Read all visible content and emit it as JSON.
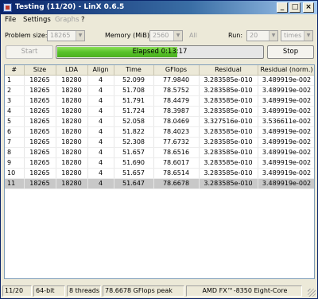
{
  "window": {
    "title": "Testing (11/20) - LinX 0.6.5"
  },
  "titlebar_buttons": {
    "minimize": "_",
    "maximize": "□",
    "close": "×"
  },
  "menu": {
    "file": "File",
    "settings": "Settings",
    "graphs": "Graphs",
    "help": "?"
  },
  "controls": {
    "problem_size_label": "Problem size:",
    "problem_size_value": "18265",
    "memory_label": "Memory (MiB):",
    "memory_value": "2560",
    "all_label": "All",
    "run_label": "Run:",
    "run_value": "20",
    "run_unit": "times"
  },
  "buttons": {
    "start": "Start",
    "stop": "Stop"
  },
  "progress": {
    "text": "Elapsed 0:13:17",
    "fraction": 0.58
  },
  "table": {
    "headers": [
      "#",
      "Size",
      "LDA",
      "Align",
      "Time",
      "GFlops",
      "Residual",
      "Residual (norm.)"
    ],
    "rows": [
      [
        "1",
        "18265",
        "18280",
        "4",
        "52.099",
        "77.9840",
        "3.283585e-010",
        "3.489919e-002"
      ],
      [
        "2",
        "18265",
        "18280",
        "4",
        "51.708",
        "78.5752",
        "3.283585e-010",
        "3.489919e-002"
      ],
      [
        "3",
        "18265",
        "18280",
        "4",
        "51.791",
        "78.4479",
        "3.283585e-010",
        "3.489919e-002"
      ],
      [
        "4",
        "18265",
        "18280",
        "4",
        "51.724",
        "78.3987",
        "3.283585e-010",
        "3.489919e-002"
      ],
      [
        "5",
        "18265",
        "18280",
        "4",
        "52.058",
        "78.0469",
        "3.327516e-010",
        "3.536611e-002"
      ],
      [
        "6",
        "18265",
        "18280",
        "4",
        "51.822",
        "78.4023",
        "3.283585e-010",
        "3.489919e-002"
      ],
      [
        "7",
        "18265",
        "18280",
        "4",
        "52.308",
        "77.6732",
        "3.283585e-010",
        "3.489919e-002"
      ],
      [
        "8",
        "18265",
        "18280",
        "4",
        "51.657",
        "78.6516",
        "3.283585e-010",
        "3.489919e-002"
      ],
      [
        "9",
        "18265",
        "18280",
        "4",
        "51.690",
        "78.6017",
        "3.283585e-010",
        "3.489919e-002"
      ],
      [
        "10",
        "18265",
        "18280",
        "4",
        "51.657",
        "78.6514",
        "3.283585e-010",
        "3.489919e-002"
      ],
      [
        "11",
        "18265",
        "18280",
        "4",
        "51.647",
        "78.6678",
        "3.283585e-010",
        "3.489919e-002"
      ]
    ],
    "selected_row": 10
  },
  "status": {
    "progress": "11/20",
    "bits": "64-bit",
    "threads": "8 threads",
    "peak": "78.6678 GFlops peak",
    "cpu": "AMD FX™-8350 Eight-Core"
  }
}
